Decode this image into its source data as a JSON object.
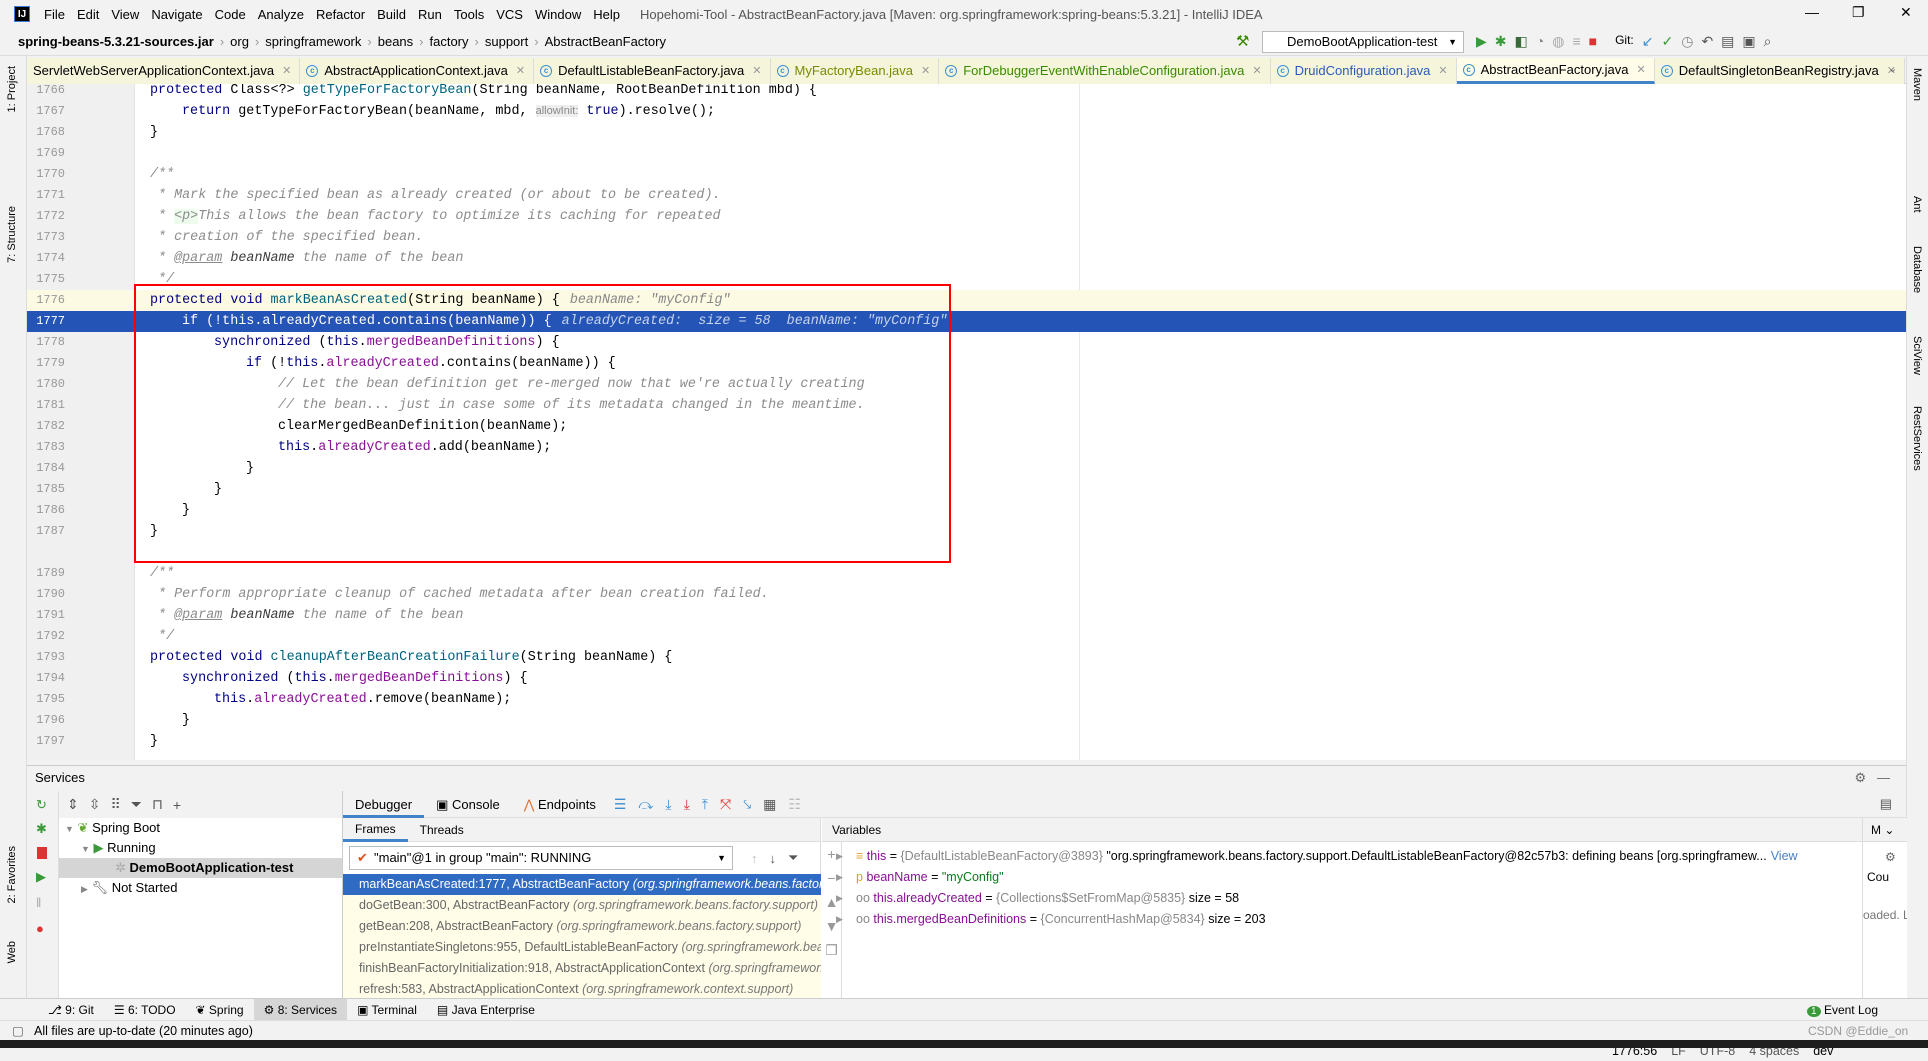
{
  "menu": {
    "items": [
      "File",
      "Edit",
      "View",
      "Navigate",
      "Code",
      "Analyze",
      "Refactor",
      "Build",
      "Run",
      "Tools",
      "VCS",
      "Window",
      "Help"
    ],
    "title": "Hopehomi-Tool - AbstractBeanFactory.java [Maven: org.springframework:spring-beans:5.3.21] - IntelliJ IDEA"
  },
  "breadcrumb": [
    "spring-beans-5.3.21-sources.jar",
    "org",
    "springframework",
    "beans",
    "factory",
    "support",
    "AbstractBeanFactory"
  ],
  "run_config": "DemoBootApplication-test",
  "git_label": "Git:",
  "tabs": [
    {
      "label": "ServletWebServerApplicationContext.java",
      "color": "#000000"
    },
    {
      "label": "AbstractApplicationContext.java",
      "color": "#000000"
    },
    {
      "label": "DefaultListableBeanFactory.java",
      "color": "#000000"
    },
    {
      "label": "MyFactoryBean.java",
      "color": "#7a8a00"
    },
    {
      "label": "ForDebuggerEventWithEnableConfiguration.java",
      "color": "#3a8a00"
    },
    {
      "label": "DruidConfiguration.java",
      "color": "#2a5bb8"
    },
    {
      "label": "AbstractBeanFactory.java",
      "color": "#000000",
      "active": true
    },
    {
      "label": "DefaultSingletonBeanRegistry.java",
      "color": "#000000"
    }
  ],
  "left_tools": [
    "1: Project",
    "7: Structure",
    "2: Favorites",
    "Web"
  ],
  "right_tools": [
    "Maven",
    "Ant",
    "Database",
    "SciView",
    "RestServices"
  ],
  "code": [
    {
      "n": "1766",
      "i": 0,
      "t": [
        [
          "kw",
          "protected "
        ],
        [
          "",
          "Class<?> "
        ],
        [
          "fn",
          "getTypeForFactoryBean"
        ],
        [
          "",
          "(String beanName, RootBeanDefinition mbd) {"
        ]
      ]
    },
    {
      "n": "1767",
      "i": 1,
      "t": [
        [
          "kw",
          "return "
        ],
        [
          "",
          "getTypeForFactoryBean(beanName, mbd, "
        ],
        [
          "hint",
          "allowInit:"
        ],
        [
          "kw",
          " true"
        ],
        [
          "",
          ").resolve();"
        ]
      ]
    },
    {
      "n": "1768",
      "i": 0,
      "t": [
        [
          "",
          "}"
        ]
      ]
    },
    {
      "n": "1769",
      "i": 0,
      "t": []
    },
    {
      "n": "1770",
      "i": 0,
      "t": [
        [
          "cm",
          "/**"
        ]
      ]
    },
    {
      "n": "1771",
      "i": 0,
      "t": [
        [
          "cm",
          " * Mark the specified bean as already created (or about to be created)."
        ]
      ]
    },
    {
      "n": "1772",
      "i": 0,
      "t": [
        [
          "cm",
          " * "
        ],
        [
          "tag",
          "<p>"
        ],
        [
          "cm",
          "This allows the bean factory to optimize its caching for repeated"
        ]
      ]
    },
    {
      "n": "1773",
      "i": 0,
      "t": [
        [
          "cm",
          " * creation of the specified bean."
        ]
      ]
    },
    {
      "n": "1774",
      "i": 0,
      "t": [
        [
          "cm",
          " * "
        ],
        [
          "dt",
          "@param"
        ],
        [
          "pr",
          " beanName"
        ],
        [
          "cm",
          " the name of the bean"
        ]
      ]
    },
    {
      "n": "1775",
      "i": 0,
      "t": [
        [
          "cm",
          " */"
        ]
      ]
    },
    {
      "n": "1776",
      "i": 0,
      "cur": true,
      "t": [
        [
          "kw",
          "protected void "
        ],
        [
          "fn",
          "markBeanAsCreated"
        ],
        [
          "",
          "(String beanName) {"
        ]
      ],
      "inline": "beanName: \"myConfig\""
    },
    {
      "n": "1777",
      "i": 1,
      "sel": true,
      "bp": true,
      "t": [
        [
          "",
          "if (!this.alreadyCreated.contains(beanName)) {"
        ]
      ],
      "inline": "alreadyCreated:  size = 58  beanName: \"myConfig\""
    },
    {
      "n": "1778",
      "i": 2,
      "t": [
        [
          "kw",
          "synchronized "
        ],
        [
          "",
          "("
        ],
        [
          "kw",
          "this"
        ],
        [
          "",
          "."
        ],
        [
          "fd",
          "mergedBeanDefinitions"
        ],
        [
          "",
          ") {"
        ]
      ]
    },
    {
      "n": "1779",
      "i": 3,
      "t": [
        [
          "kw",
          "if "
        ],
        [
          "",
          "(!"
        ],
        [
          "kw",
          "this"
        ],
        [
          "",
          "."
        ],
        [
          "fd",
          "alreadyCreated"
        ],
        [
          "",
          ".contains(beanName)) {"
        ]
      ]
    },
    {
      "n": "1780",
      "i": 4,
      "t": [
        [
          "cm",
          "// Let the bean definition get re-merged now that we're actually creating"
        ]
      ]
    },
    {
      "n": "1781",
      "i": 4,
      "t": [
        [
          "cm",
          "// the bean... just in case some of its metadata changed in the meantime."
        ]
      ]
    },
    {
      "n": "1782",
      "i": 4,
      "t": [
        [
          "",
          "clearMergedBeanDefinition(beanName);"
        ]
      ]
    },
    {
      "n": "1783",
      "i": 4,
      "t": [
        [
          "kw",
          "this"
        ],
        [
          "",
          "."
        ],
        [
          "fd",
          "alreadyCreated"
        ],
        [
          "",
          ".add(beanName);"
        ]
      ]
    },
    {
      "n": "1784",
      "i": 3,
      "t": [
        [
          "",
          "}"
        ]
      ]
    },
    {
      "n": "1785",
      "i": 2,
      "t": [
        [
          "",
          "}"
        ]
      ]
    },
    {
      "n": "1786",
      "i": 1,
      "t": [
        [
          "",
          "}"
        ]
      ]
    },
    {
      "n": "1787",
      "i": 0,
      "t": [
        [
          "",
          "}"
        ]
      ]
    },
    {
      "n": "",
      "i": 0,
      "t": []
    },
    {
      "n": "1789",
      "i": 0,
      "t": [
        [
          "cm",
          "/**"
        ]
      ]
    },
    {
      "n": "1790",
      "i": 0,
      "t": [
        [
          "cm",
          " * Perform appropriate cleanup of cached metadata after bean creation failed."
        ]
      ]
    },
    {
      "n": "1791",
      "i": 0,
      "t": [
        [
          "cm",
          " * "
        ],
        [
          "dt",
          "@param"
        ],
        [
          "pr",
          " beanName"
        ],
        [
          "cm",
          " the name of the bean"
        ]
      ]
    },
    {
      "n": "1792",
      "i": 0,
      "t": [
        [
          "cm",
          " */"
        ]
      ]
    },
    {
      "n": "1793",
      "i": 0,
      "t": [
        [
          "kw",
          "protected void "
        ],
        [
          "fn",
          "cleanupAfterBeanCreationFailure"
        ],
        [
          "",
          "(String beanName) {"
        ]
      ]
    },
    {
      "n": "1794",
      "i": 1,
      "t": [
        [
          "kw",
          "synchronized "
        ],
        [
          "",
          "("
        ],
        [
          "kw",
          "this"
        ],
        [
          "",
          "."
        ],
        [
          "fd",
          "mergedBeanDefinitions"
        ],
        [
          "",
          ") {"
        ]
      ]
    },
    {
      "n": "1795",
      "i": 2,
      "t": [
        [
          "kw",
          "this"
        ],
        [
          "",
          "."
        ],
        [
          "fd",
          "alreadyCreated"
        ],
        [
          "",
          ".remove(beanName);"
        ]
      ]
    },
    {
      "n": "1796",
      "i": 1,
      "t": [
        [
          "",
          "}"
        ]
      ]
    },
    {
      "n": "1797",
      "i": 0,
      "t": [
        [
          "",
          "}"
        ]
      ]
    }
  ],
  "services": {
    "title": "Services",
    "tree": [
      {
        "label": "Spring Boot",
        "level": 0
      },
      {
        "label": "Running",
        "level": 1
      },
      {
        "label": "DemoBootApplication-test",
        "level": 2,
        "selected": true
      },
      {
        "label": "Not Started",
        "level": 1
      }
    ]
  },
  "debugger": {
    "tabs": [
      "Debugger",
      "Console",
      "Endpoints"
    ],
    "frames_tabs": [
      "Frames",
      "Threads"
    ],
    "thread": "\"main\"@1 in group \"main\": RUNNING",
    "frames": [
      {
        "m": "markBeanAsCreated:1777, AbstractBeanFactory",
        "p": "(org.springframework.beans.factory.support)",
        "sel": true
      },
      {
        "m": "doGetBean:300, AbstractBeanFactory",
        "p": "(org.springframework.beans.factory.support)"
      },
      {
        "m": "getBean:208, AbstractBeanFactory",
        "p": "(org.springframework.beans.factory.support)"
      },
      {
        "m": "preInstantiateSingletons:955, DefaultListableBeanFactory",
        "p": "(org.springframework.beans.factory.support)"
      },
      {
        "m": "finishBeanFactoryInitialization:918, AbstractApplicationContext",
        "p": "(org.springframework.context.support)"
      },
      {
        "m": "refresh:583, AbstractApplicationContext",
        "p": "(org.springframework.context.support)"
      }
    ],
    "variables_title": "Variables",
    "variables": [
      {
        "name": "this",
        "type": "{DefaultListableBeanFactory@3893}",
        "value": "\"org.springframework.beans.factory.support.DefaultListableBeanFactory@82c57b3: defining beans [org.springframew...",
        "link": "View"
      },
      {
        "name": "beanName",
        "type": "",
        "value": "\"myConfig\"",
        "str": true
      },
      {
        "name": "this.alreadyCreated",
        "type": "{Collections$SetFromMap@5835}",
        "value": "size = 58"
      },
      {
        "name": "this.mergedBeanDefinitions",
        "type": "{ConcurrentHashMap@5834}",
        "value": "size = 203"
      }
    ],
    "side_texts": [
      "Cou",
      "oaded. L"
    ]
  },
  "bottom_tools": [
    "9: Git",
    "6: TODO",
    "Spring",
    "8: Services",
    "Terminal",
    "Java Enterprise"
  ],
  "event_log": "Event Log",
  "status": {
    "message": "All files are up-to-date (20 minutes ago)",
    "position": "1776:56",
    "line_sep": "LF",
    "encoding": "UTF-8",
    "indent": "4 spaces",
    "branch": "dev",
    "watermark": "CSDN @Eddie_on"
  }
}
